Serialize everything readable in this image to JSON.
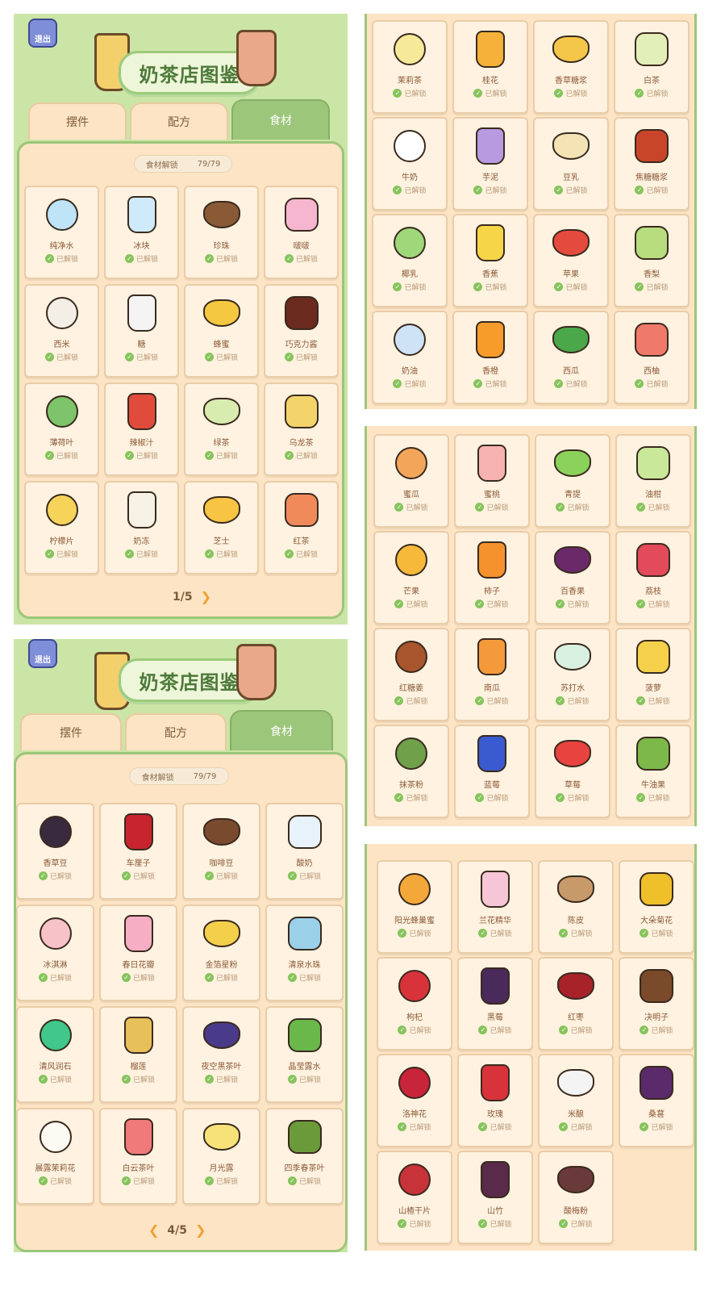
{
  "shared": {
    "title": "奶茶店图鉴",
    "exit": "退出",
    "tabs": [
      "摆件",
      "配方",
      "食材"
    ],
    "counter_label": "食材解锁",
    "counter_value": "79/79",
    "status_text": "已解锁",
    "check_glyph": "✓"
  },
  "page1": {
    "pager": "1/5",
    "next": "❯",
    "items": [
      {
        "name": "纯净水",
        "color": "#bfe3f7",
        "icon": "water-bottle-icon"
      },
      {
        "name": "冰块",
        "color": "#cfeafb",
        "icon": "ice-cube-icon"
      },
      {
        "name": "珍珠",
        "color": "#8a5a36",
        "icon": "pearl-cup-icon"
      },
      {
        "name": "啵啵",
        "color": "#f6b6cf",
        "icon": "boba-bowl-icon"
      },
      {
        "name": "西米",
        "color": "#f3efe7",
        "icon": "sago-bowl-icon"
      },
      {
        "name": "糖",
        "color": "#f4f4f4",
        "icon": "sugar-jar-icon"
      },
      {
        "name": "蜂蜜",
        "color": "#f5c842",
        "icon": "honey-jar-icon"
      },
      {
        "name": "巧克力酱",
        "color": "#6b2a1e",
        "icon": "chocolate-sauce-icon"
      },
      {
        "name": "薄荷叶",
        "color": "#7ec46a",
        "icon": "mint-leaf-icon"
      },
      {
        "name": "辣椒汁",
        "color": "#e14b3b",
        "icon": "chili-jar-icon"
      },
      {
        "name": "绿茶",
        "color": "#d9ecb0",
        "icon": "green-tea-icon"
      },
      {
        "name": "乌龙茶",
        "color": "#f3d46b",
        "icon": "oolong-tea-icon"
      },
      {
        "name": "柠檬片",
        "color": "#f6d45a",
        "icon": "lemon-slice-icon"
      },
      {
        "name": "奶冻",
        "color": "#f7f2e6",
        "icon": "milk-jelly-icon"
      },
      {
        "name": "芝士",
        "color": "#f7c443",
        "icon": "cheese-icon"
      },
      {
        "name": "红茶",
        "color": "#f08a5a",
        "icon": "black-tea-icon"
      }
    ]
  },
  "page2": {
    "items": [
      {
        "name": "茉莉茶",
        "color": "#f6ea9a",
        "icon": "jasmine-tea-icon"
      },
      {
        "name": "桂花",
        "color": "#f5b13a",
        "icon": "osmanthus-icon"
      },
      {
        "name": "香草糖浆",
        "color": "#f4c64a",
        "icon": "vanilla-syrup-icon"
      },
      {
        "name": "白茶",
        "color": "#e3efb9",
        "icon": "white-tea-icon"
      },
      {
        "name": "牛奶",
        "color": "#ffffff",
        "icon": "milk-jug-icon"
      },
      {
        "name": "芋泥",
        "color": "#b79ae0",
        "icon": "taro-paste-icon"
      },
      {
        "name": "豆乳",
        "color": "#f4e3b5",
        "icon": "soy-milk-icon"
      },
      {
        "name": "焦糖糖浆",
        "color": "#c9452a",
        "icon": "caramel-syrup-icon"
      },
      {
        "name": "椰乳",
        "color": "#9fd77a",
        "icon": "coconut-icon"
      },
      {
        "name": "香蕉",
        "color": "#f6d548",
        "icon": "banana-icon"
      },
      {
        "name": "苹果",
        "color": "#e44a3e",
        "icon": "apple-icon"
      },
      {
        "name": "香梨",
        "color": "#b7dd7f",
        "icon": "pear-icon"
      },
      {
        "name": "奶油",
        "color": "#cfe3f7",
        "icon": "cream-can-icon"
      },
      {
        "name": "香橙",
        "color": "#f79c2b",
        "icon": "orange-icon"
      },
      {
        "name": "西瓜",
        "color": "#4aa84a",
        "icon": "watermelon-icon"
      },
      {
        "name": "西柚",
        "color": "#f07a6a",
        "icon": "grapefruit-icon"
      }
    ]
  },
  "page3": {
    "items": [
      {
        "name": "蜜瓜",
        "color": "#f3a65a",
        "icon": "melon-icon"
      },
      {
        "name": "蜜桃",
        "color": "#f7b3b0",
        "icon": "peach-icon"
      },
      {
        "name": "青提",
        "color": "#8ad25a",
        "icon": "green-grape-icon"
      },
      {
        "name": "油柑",
        "color": "#c9e89a",
        "icon": "emblic-icon"
      },
      {
        "name": "芒果",
        "color": "#f6b93a",
        "icon": "mango-icon"
      },
      {
        "name": "柿子",
        "color": "#f5922e",
        "icon": "persimmon-icon"
      },
      {
        "name": "百香果",
        "color": "#6a2a6a",
        "icon": "passion-fruit-icon"
      },
      {
        "name": "荔枝",
        "color": "#e34a5a",
        "icon": "lychee-icon"
      },
      {
        "name": "红糖姜",
        "color": "#a8552e",
        "icon": "brown-sugar-ginger-icon"
      },
      {
        "name": "南瓜",
        "color": "#f59a3a",
        "icon": "pumpkin-icon"
      },
      {
        "name": "苏打水",
        "color": "#d8f0e0",
        "icon": "soda-water-icon"
      },
      {
        "name": "菠萝",
        "color": "#f5d04a",
        "icon": "pineapple-icon"
      },
      {
        "name": "抹茶粉",
        "color": "#6fa04a",
        "icon": "matcha-powder-icon"
      },
      {
        "name": "蓝莓",
        "color": "#3a5acf",
        "icon": "blueberry-icon"
      },
      {
        "name": "草莓",
        "color": "#e8433e",
        "icon": "strawberry-icon"
      },
      {
        "name": "牛油果",
        "color": "#7cb84a",
        "icon": "avocado-icon"
      }
    ]
  },
  "page4": {
    "pager": "4/5",
    "prev": "❮",
    "next": "❯",
    "items": [
      {
        "name": "香草豆",
        "color": "#3a2a3e",
        "icon": "vanilla-bean-icon"
      },
      {
        "name": "车厘子",
        "color": "#c8242e",
        "icon": "cherry-icon"
      },
      {
        "name": "咖啡豆",
        "color": "#7a4a2e",
        "icon": "coffee-bean-icon"
      },
      {
        "name": "酸奶",
        "color": "#e8f2fb",
        "icon": "yogurt-jar-icon"
      },
      {
        "name": "冰淇淋",
        "color": "#f7c2c8",
        "icon": "ice-cream-icon"
      },
      {
        "name": "春日花瓣",
        "color": "#f6aec4",
        "icon": "spring-petal-icon"
      },
      {
        "name": "金箔星粉",
        "color": "#f3cf4a",
        "icon": "gold-star-powder-icon"
      },
      {
        "name": "清泉水珠",
        "color": "#9ad0e8",
        "icon": "spring-water-bead-icon"
      },
      {
        "name": "清风润石",
        "color": "#3fc88a",
        "icon": "breeze-stone-icon"
      },
      {
        "name": "榴莲",
        "color": "#e8c05a",
        "icon": "durian-icon"
      },
      {
        "name": "夜空黑茶叶",
        "color": "#4a3a8a",
        "icon": "night-tea-leaf-icon"
      },
      {
        "name": "晶莹露水",
        "color": "#6ab84a",
        "icon": "crystal-dew-icon"
      },
      {
        "name": "晨露茉莉花",
        "color": "#fbfbf3",
        "icon": "morning-jasmine-icon"
      },
      {
        "name": "白云茶叶",
        "color": "#f07a7a",
        "icon": "cloud-tea-leaf-icon"
      },
      {
        "name": "月光露",
        "color": "#f7e27a",
        "icon": "moonlight-dew-icon"
      },
      {
        "name": "四季春茶叶",
        "color": "#6a9a3a",
        "icon": "four-season-tea-icon"
      }
    ]
  },
  "page5": {
    "items": [
      {
        "name": "阳光蜂巢蜜",
        "color": "#f5a83a",
        "icon": "honeycomb-icon"
      },
      {
        "name": "兰花精华",
        "color": "#f6c6d6",
        "icon": "orchid-essence-icon"
      },
      {
        "name": "陈皮",
        "color": "#c89a6a",
        "icon": "dried-peel-icon"
      },
      {
        "name": "大朵菊花",
        "color": "#f0c02a",
        "icon": "chrysanthemum-icon"
      },
      {
        "name": "枸杞",
        "color": "#d8333a",
        "icon": "goji-icon"
      },
      {
        "name": "黑莓",
        "color": "#4a2a5a",
        "icon": "blackberry-icon"
      },
      {
        "name": "红枣",
        "color": "#a8222a",
        "icon": "red-date-icon"
      },
      {
        "name": "决明子",
        "color": "#7a4a2a",
        "icon": "cassia-seed-icon"
      },
      {
        "name": "洛神花",
        "color": "#c8243a",
        "icon": "roselle-icon"
      },
      {
        "name": "玫瑰",
        "color": "#d8333a",
        "icon": "rose-icon"
      },
      {
        "name": "米酿",
        "color": "#f4f4f4",
        "icon": "rice-wine-icon"
      },
      {
        "name": "桑葚",
        "color": "#5a2a6a",
        "icon": "mulberry-icon"
      },
      {
        "name": "山楂干片",
        "color": "#c8333a",
        "icon": "hawthorn-slice-icon"
      },
      {
        "name": "山竹",
        "color": "#5a2a4a",
        "icon": "mangosteen-icon"
      },
      {
        "name": "酸梅粉",
        "color": "#6a3a3a",
        "icon": "plum-powder-icon"
      }
    ]
  }
}
